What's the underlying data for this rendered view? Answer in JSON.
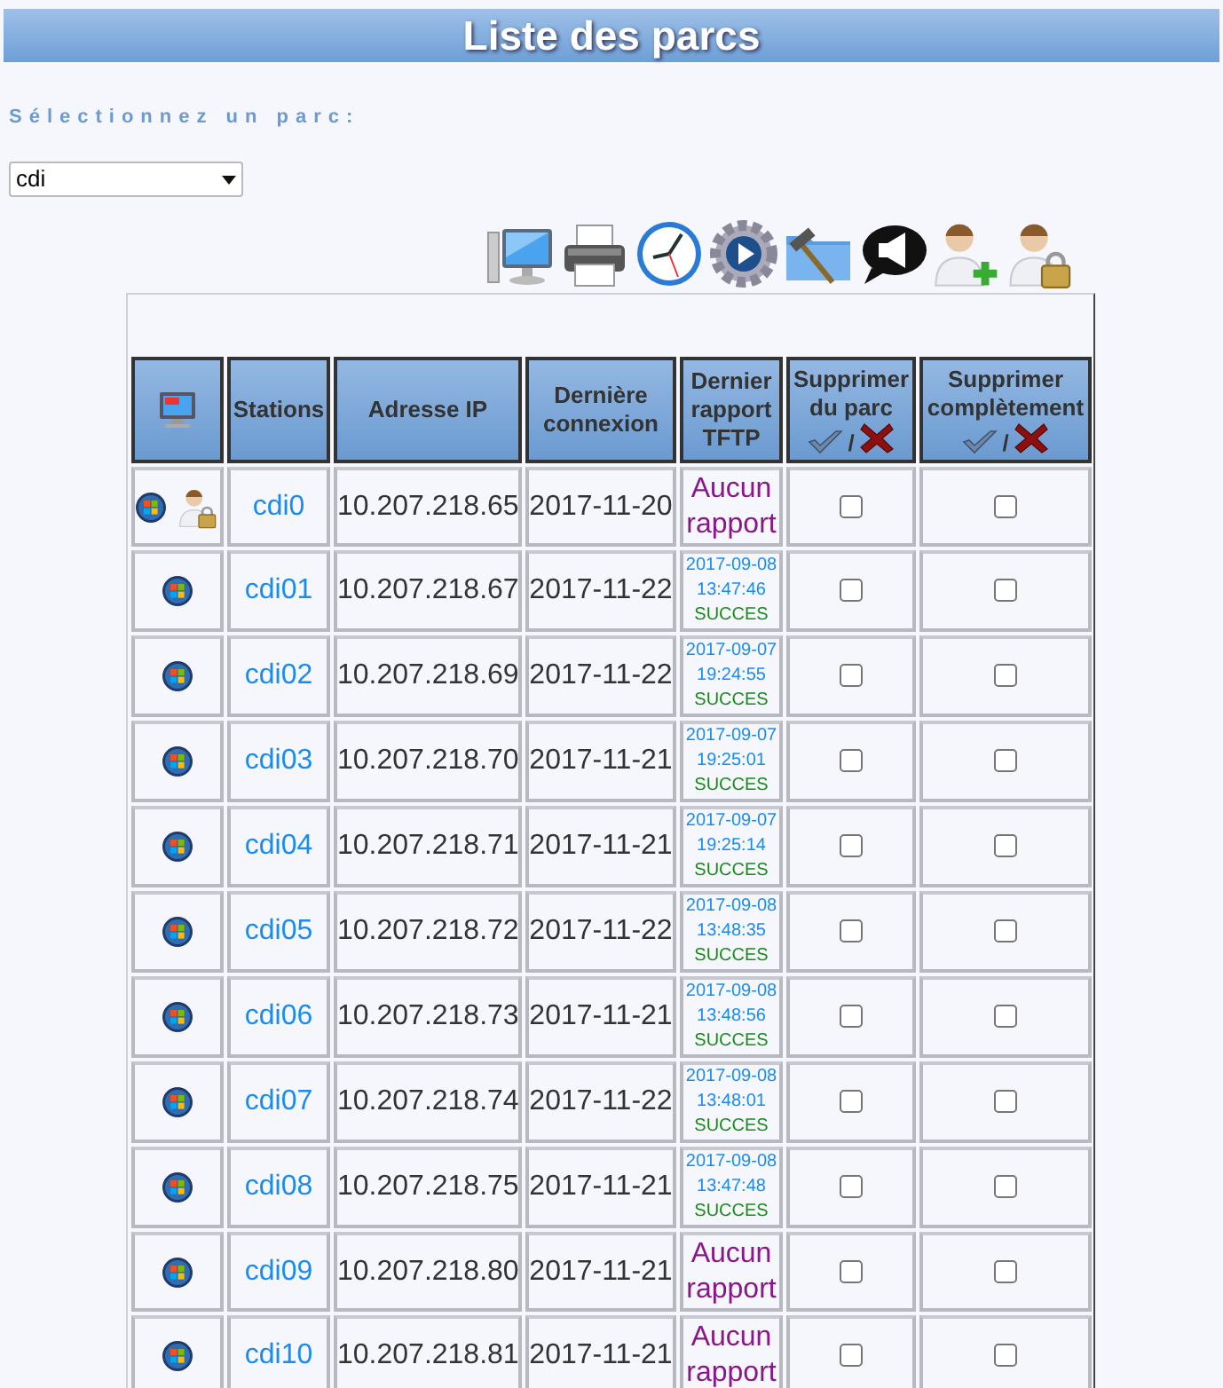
{
  "title": "Liste des parcs",
  "park_select": {
    "label": "Sélectionnez un parc:",
    "value": "cdi"
  },
  "columns": [
    {
      "kind": "icon"
    },
    {
      "kind": "text",
      "label": "Stations"
    },
    {
      "kind": "text",
      "label": "Adresse IP"
    },
    {
      "kind": "text",
      "label": "Dernière connexion"
    },
    {
      "kind": "text",
      "label": "Dernier rapport TFTP"
    },
    {
      "kind": "action",
      "label": "Supprimer du parc",
      "separator": "/"
    },
    {
      "kind": "action",
      "label": "Supprimer complètement",
      "separator": "/"
    }
  ],
  "rows": [
    {
      "locked": true,
      "station": "cdi0",
      "ip": "10.207.218.65",
      "last_connection": "2017-11-20",
      "report": {
        "kind": "none",
        "text": "Aucun rapport"
      },
      "remove_from_park": false,
      "remove_completely": false
    },
    {
      "locked": false,
      "station": "cdi01",
      "ip": "10.207.218.67",
      "last_connection": "2017-11-22",
      "report": {
        "kind": "report",
        "date": "2017-09-08",
        "time": "13:47:46",
        "status": "SUCCES"
      },
      "remove_from_park": false,
      "remove_completely": false
    },
    {
      "locked": false,
      "station": "cdi02",
      "ip": "10.207.218.69",
      "last_connection": "2017-11-22",
      "report": {
        "kind": "report",
        "date": "2017-09-07",
        "time": "19:24:55",
        "status": "SUCCES"
      },
      "remove_from_park": false,
      "remove_completely": false
    },
    {
      "locked": false,
      "station": "cdi03",
      "ip": "10.207.218.70",
      "last_connection": "2017-11-21",
      "report": {
        "kind": "report",
        "date": "2017-09-07",
        "time": "19:25:01",
        "status": "SUCCES"
      },
      "remove_from_park": false,
      "remove_completely": false
    },
    {
      "locked": false,
      "station": "cdi04",
      "ip": "10.207.218.71",
      "last_connection": "2017-11-21",
      "report": {
        "kind": "report",
        "date": "2017-09-07",
        "time": "19:25:14",
        "status": "SUCCES"
      },
      "remove_from_park": false,
      "remove_completely": false
    },
    {
      "locked": false,
      "station": "cdi05",
      "ip": "10.207.218.72",
      "last_connection": "2017-11-22",
      "report": {
        "kind": "report",
        "date": "2017-09-08",
        "time": "13:48:35",
        "status": "SUCCES"
      },
      "remove_from_park": false,
      "remove_completely": false
    },
    {
      "locked": false,
      "station": "cdi06",
      "ip": "10.207.218.73",
      "last_connection": "2017-11-21",
      "report": {
        "kind": "report",
        "date": "2017-09-08",
        "time": "13:48:56",
        "status": "SUCCES"
      },
      "remove_from_park": false,
      "remove_completely": false
    },
    {
      "locked": false,
      "station": "cdi07",
      "ip": "10.207.218.74",
      "last_connection": "2017-11-22",
      "report": {
        "kind": "report",
        "date": "2017-09-08",
        "time": "13:48:01",
        "status": "SUCCES"
      },
      "remove_from_park": false,
      "remove_completely": false
    },
    {
      "locked": false,
      "station": "cdi08",
      "ip": "10.207.218.75",
      "last_connection": "2017-11-21",
      "report": {
        "kind": "report",
        "date": "2017-09-08",
        "time": "13:47:48",
        "status": "SUCCES"
      },
      "remove_from_park": false,
      "remove_completely": false
    },
    {
      "locked": false,
      "station": "cdi09",
      "ip": "10.207.218.80",
      "last_connection": "2017-11-21",
      "report": {
        "kind": "none",
        "text": "Aucun rapport"
      },
      "remove_from_park": false,
      "remove_completely": false
    },
    {
      "locked": false,
      "station": "cdi10",
      "ip": "10.207.218.81",
      "last_connection": "2017-11-21",
      "report": {
        "kind": "none",
        "text": "Aucun rapport"
      },
      "remove_from_park": false,
      "remove_completely": false
    }
  ]
}
